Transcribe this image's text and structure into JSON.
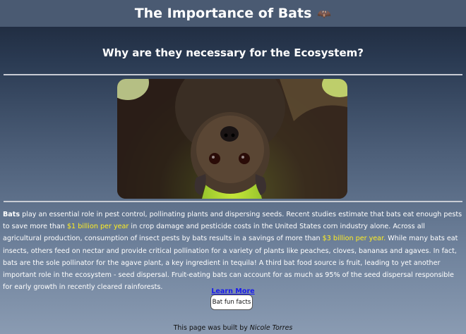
{
  "header": {
    "title": "The Importance of Bats",
    "emoji": "🦇"
  },
  "subtitle": "Why are they necessary for the Ecosystem?",
  "paragraph": {
    "lead": "Bats",
    "part1": " play an essential role in pest control, pollinating plants and dispersing seeds. Recent studies estimate that bats eat enough pests to save more than ",
    "highlight1": "$1 billion per year",
    "part2": " in crop damage and pesticide costs in the United States corn industry alone. Across all agricultural production, consumption of insect pests by bats results in a savings of more than ",
    "highlight2": "$3 billion per year.",
    "part3": " While many bats eat insects, others feed on nectar and provide critical pollination for a variety of plants like peaches, cloves, bananas and agaves. In fact, bats are the sole pollinator for the agave plant, a key ingredient in tequila! A third bat food source is fruit, leading to yet another important role in the ecosystem - seed dispersal. Fruit-eating bats can account for as much as 95% of the seed dispersal responsible for early growth in recently cleared rainforests."
  },
  "links": {
    "learn_more": "Learn More"
  },
  "buttons": {
    "fun_facts": "Bat fun facts"
  },
  "footer": {
    "prefix": "This page was built by ",
    "author": "Nicole Torres"
  },
  "colors": {
    "highlight": "#ffee22",
    "link": "#1a1aee"
  }
}
